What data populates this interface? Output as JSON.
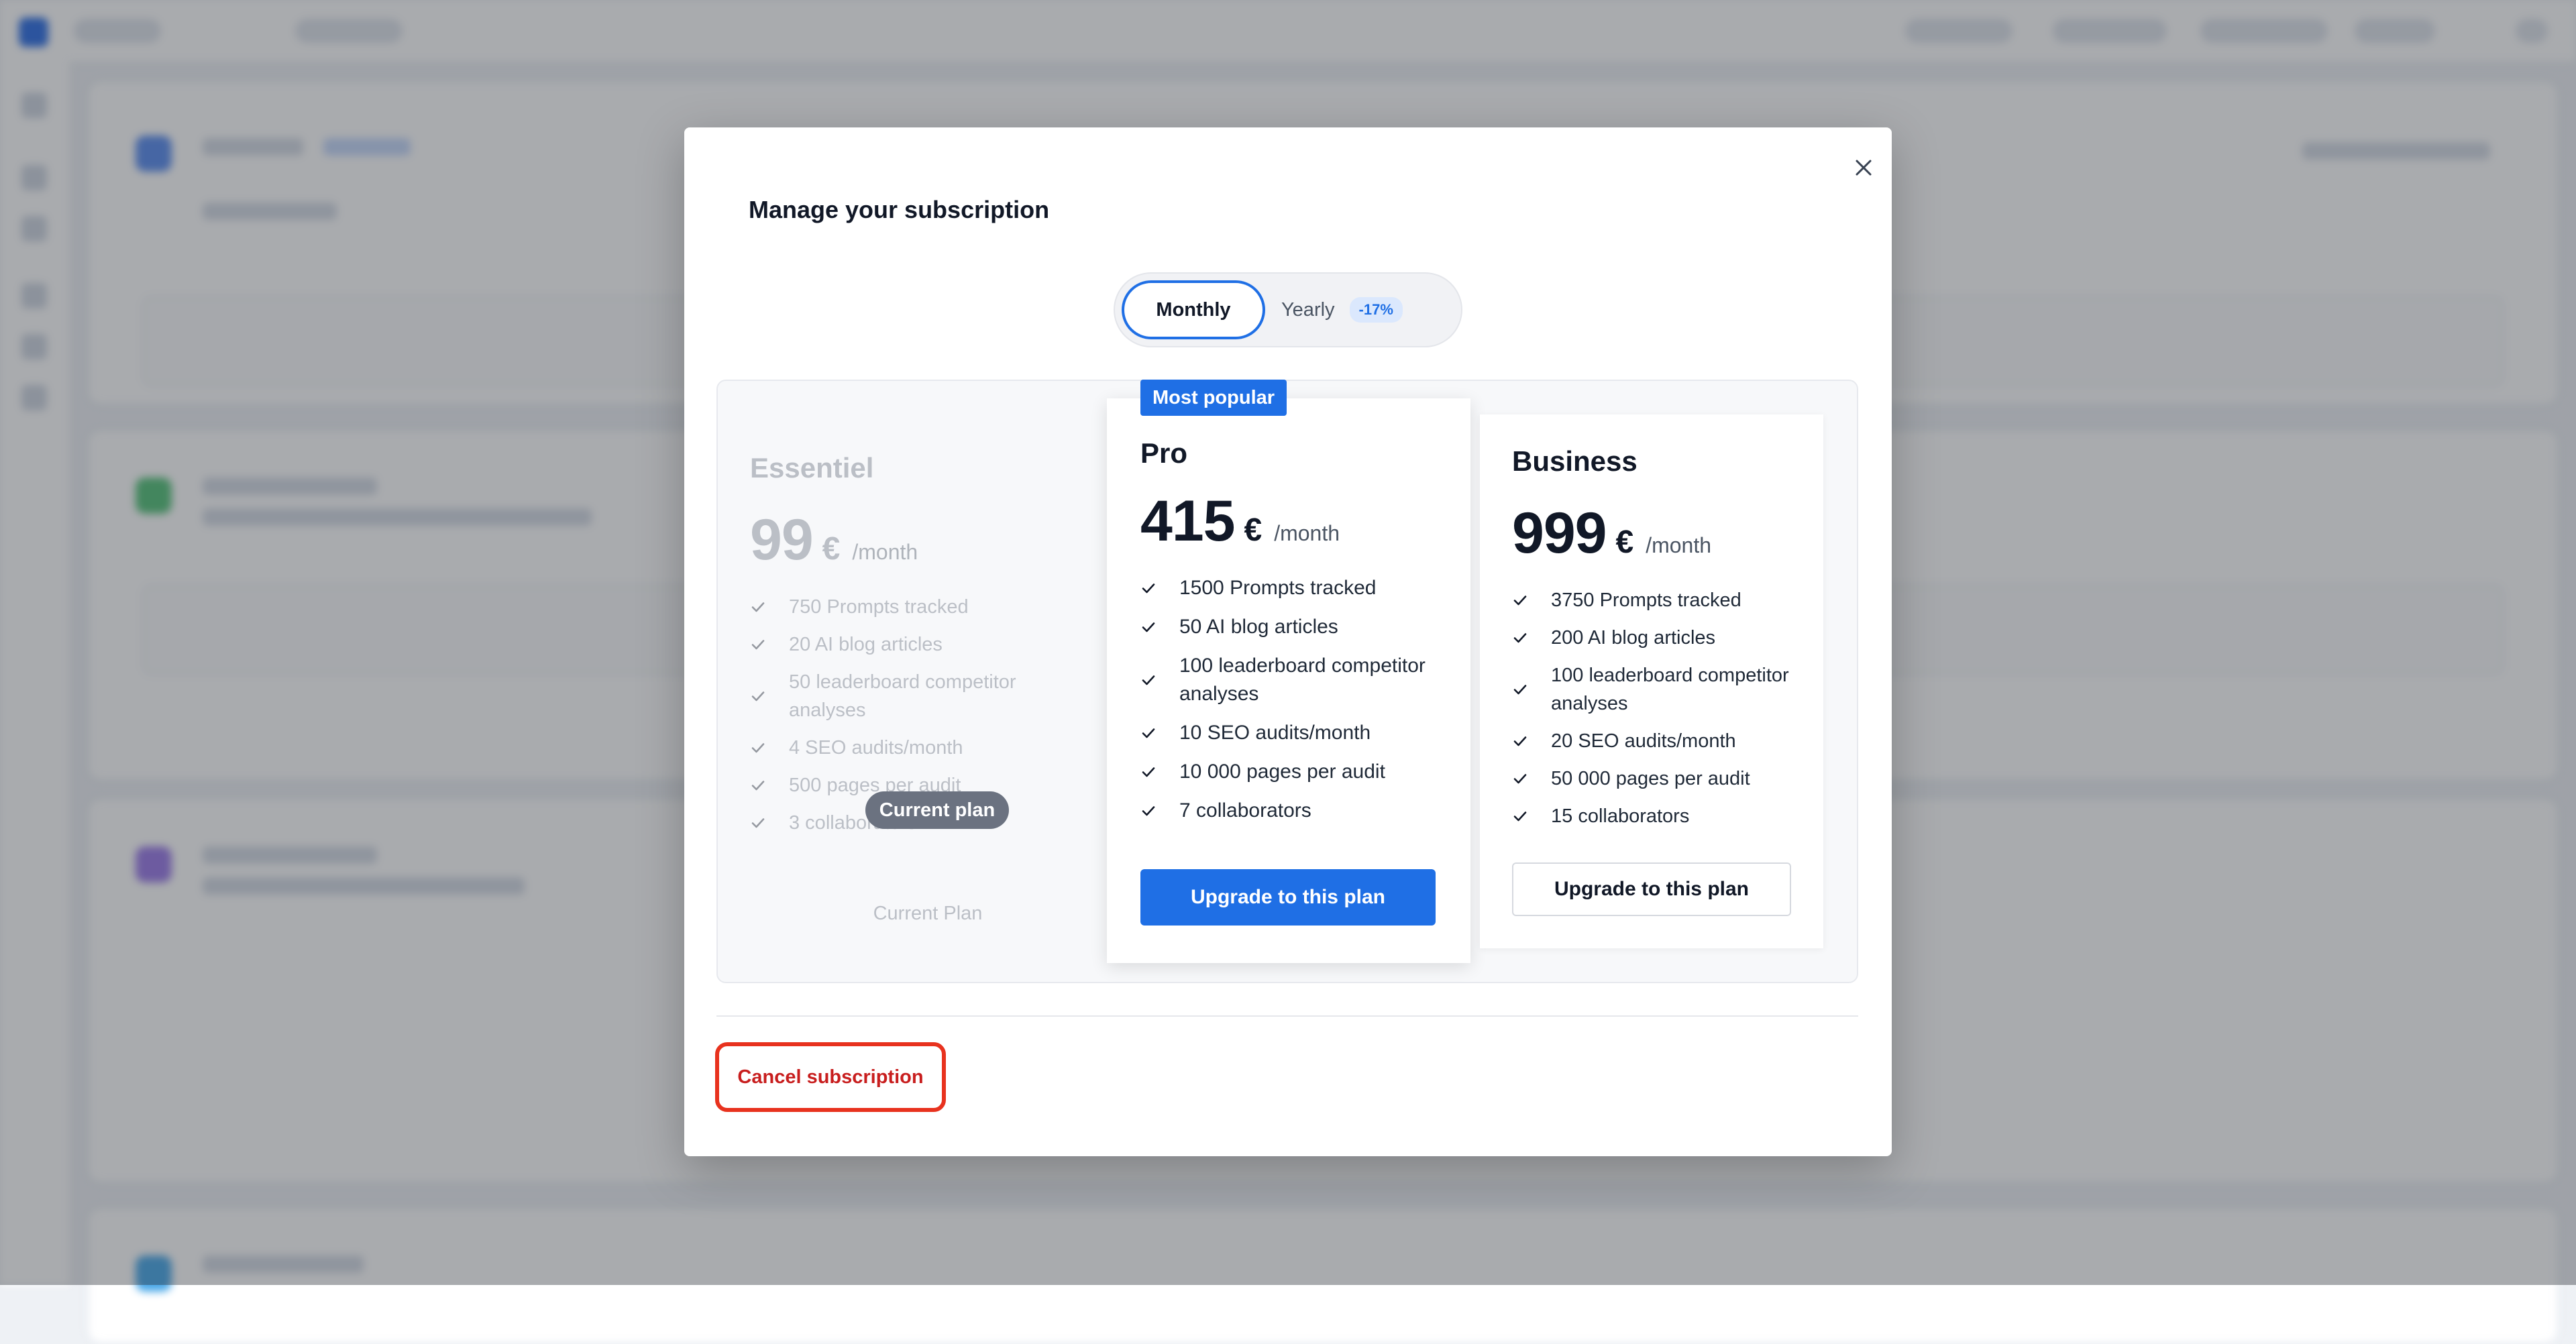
{
  "modal": {
    "title": "Manage your subscription",
    "close_icon": "close-icon"
  },
  "billing_toggle": {
    "monthly_label": "Monthly",
    "yearly_label": "Yearly",
    "yearly_discount": "-17%",
    "selected": "Monthly"
  },
  "plans": [
    {
      "name": "Essentiel",
      "price": "99",
      "currency": "€",
      "period": "/month",
      "features": [
        "750 Prompts tracked",
        "20 AI blog articles",
        "50 leaderboard competitor analyses",
        "4 SEO audits/month",
        "500 pages per audit",
        "3 collaborators"
      ],
      "current_badge": "Current plan",
      "action_label": "Current Plan"
    },
    {
      "name": "Pro",
      "badge": "Most popular",
      "price": "415",
      "currency": "€",
      "period": "/month",
      "features": [
        "1500 Prompts tracked",
        "50 AI blog articles",
        "100 leaderboard competitor analyses",
        "10 SEO audits/month",
        "10 000 pages per audit",
        "7 collaborators"
      ],
      "action_label": "Upgrade to this plan"
    },
    {
      "name": "Business",
      "price": "999",
      "currency": "€",
      "period": "/month",
      "features": [
        "3750 Prompts tracked",
        "200 AI blog articles",
        "100 leaderboard competitor analyses",
        "20 SEO audits/month",
        "50 000 pages per audit",
        "15 collaborators"
      ],
      "action_label": "Upgrade to this plan"
    }
  ],
  "footer": {
    "cancel_label": "Cancel subscription"
  },
  "colors": {
    "accent": "#1f6fe5",
    "danger": "#c81e1e",
    "highlight_outline": "#e8321e"
  }
}
